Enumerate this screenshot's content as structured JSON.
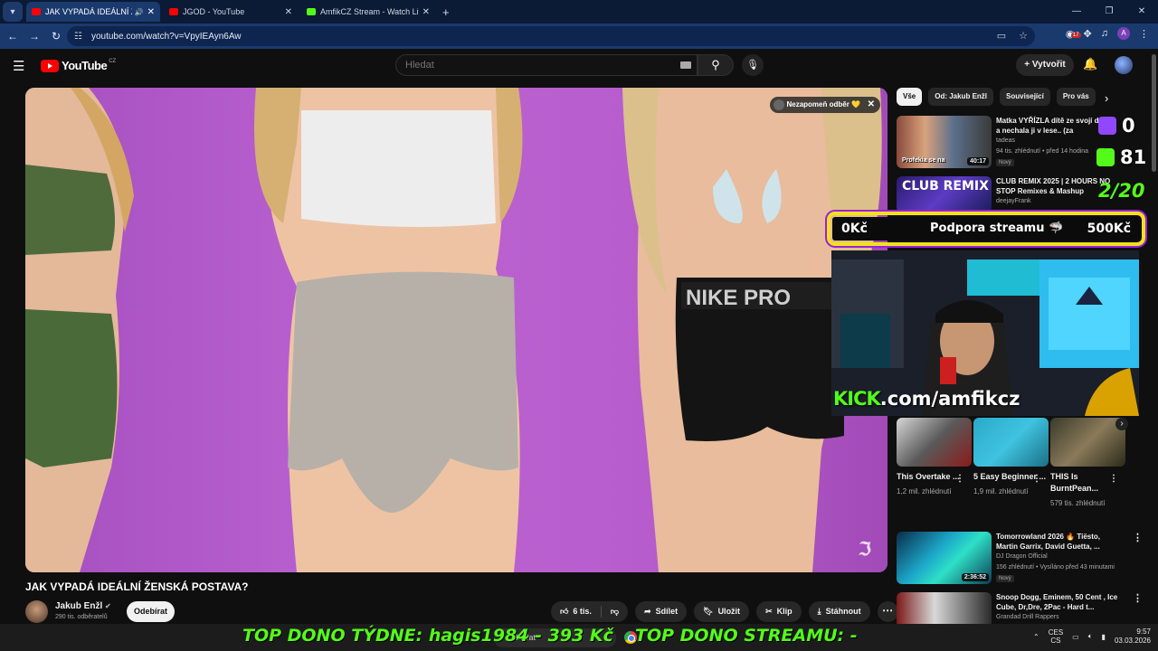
{
  "browser": {
    "tabs": [
      {
        "label": "JAK VYPADÁ IDEÁLNÍ ŽENSKÁ",
        "favicon": "youtube-icon",
        "active": true
      },
      {
        "label": "JGOD - YouTube",
        "favicon": "youtube-icon",
        "active": false
      },
      {
        "label": "AmfikCZ Stream - Watch Live o",
        "favicon": "kick-icon",
        "active": false
      }
    ],
    "url": "youtube.com/watch?v=VpyIEAyn6Aw",
    "ext_badge": "17",
    "profile_initial": "A"
  },
  "youtube": {
    "logo_text": "YouTube",
    "country_code": "CZ",
    "search_placeholder": "Hledat",
    "create_label": "Vytvořit",
    "video": {
      "title": "JAK VYPADÁ IDEÁLNÍ ŽENSKÁ POSTAVA?",
      "subscribe_reminder": "Nezapomeň odběr",
      "channel": "Jakub Enžl",
      "subscribers": "290 tis. odběratelů",
      "subscribe_label": "Odebírat",
      "likes": "6 tis.",
      "share_label": "Sdílet",
      "save_label": "Uložit",
      "clip_label": "Klip",
      "download_label": "Stáhnout"
    },
    "chips": [
      "Vše",
      "Od: Jakub Enžl",
      "Související",
      "Pro vás"
    ],
    "recommendations_top": [
      {
        "title": "Matka VYŘÍZLA dítě ze svojí dcery a nechala ji v lese.. (za",
        "channel": "tadeas",
        "meta": "94 tis. zhlédnutí • před 14 hodina",
        "badge": "Nový",
        "duration": "40:17",
        "thumb_caption": "Profekia se na"
      },
      {
        "title": "CLUB REMIX 2025 | 2 HOURS NO STOP Remixes & Mashup",
        "channel": "deejayFrank",
        "thumb_caption": "CLUB REMIX"
      }
    ],
    "shorts": [
      {
        "title": "This Overtake ...",
        "views": "1,2 mil. zhlédnutí"
      },
      {
        "title": "5 Easy Beginner ...",
        "views": "1,9 mil. zhlédnutí"
      },
      {
        "title": "THIS Is BurntPean...",
        "views": "579 tis. zhlédnutí"
      }
    ],
    "recommendations_bottom": [
      {
        "title": "Tomorrowland 2026 🔥 Tiësto, Martin Garrix, David Guetta, ...",
        "channel": "DJ Dragon Official",
        "meta": "156 zhlédnutí • Vysíláno před 43 minutami",
        "badge": "Nový",
        "duration": "2:36:52"
      },
      {
        "title": "Snoop Dogg, Eminem, 50 Cent , Ice Cube, Dr,Dre, 2Pac - Hard t...",
        "channel": "Grandad Drill Rappers"
      }
    ]
  },
  "stream_overlay": {
    "twitch_count": "0",
    "kick_count": "81",
    "goal_progress": "2/20",
    "bar_left": "0Kč",
    "bar_center": "Podpora streamu",
    "bar_right": "500Kč",
    "kick_brand": "KICK",
    "kick_url": ".com/amfikcz",
    "top_week": "TOP DONO TÝDNE:  hagis1984 - 393 Kč",
    "top_stream": "TOP DONO STREAMU: -",
    "colors": {
      "kick_green": "#53fc18",
      "bar_yellow": "#f4e11b",
      "bar_purple": "#9b1fe0"
    }
  },
  "taskbar": {
    "search_label": "Hledat",
    "lang_top": "CES",
    "lang_bottom": "CS",
    "time": "9:57",
    "date": "03.03.2026"
  }
}
